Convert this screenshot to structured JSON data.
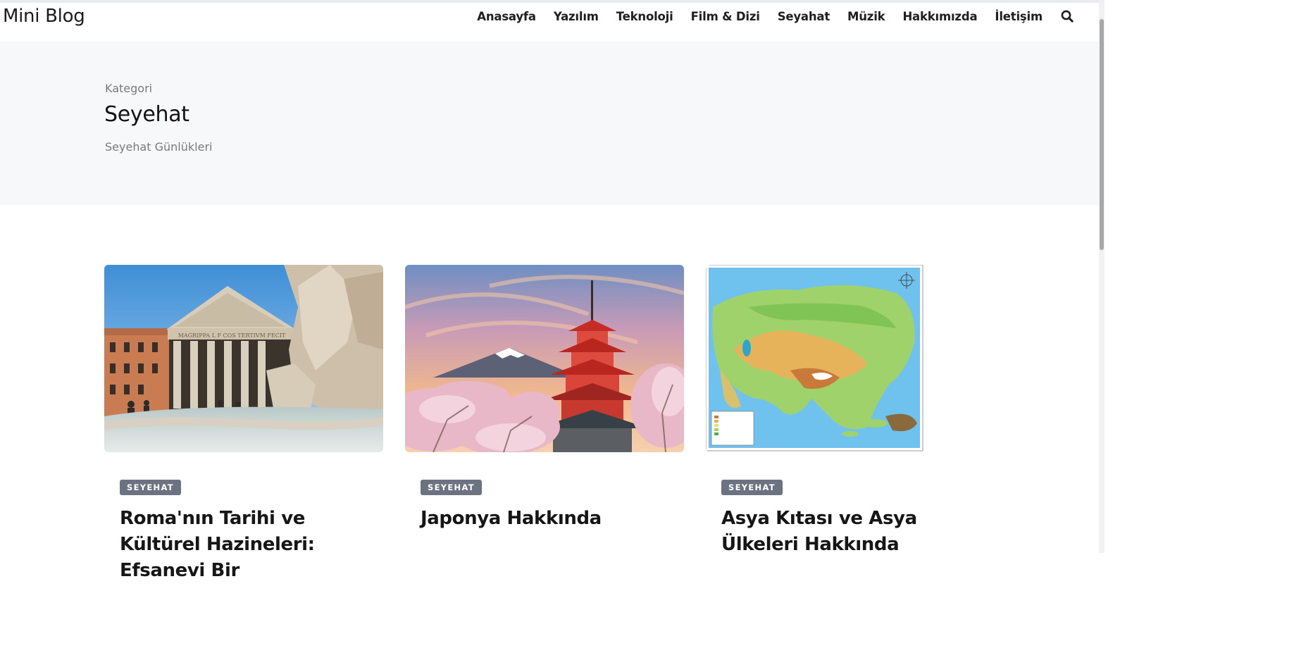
{
  "brand": "Mini Blog",
  "nav": {
    "items": [
      "Anasayfa",
      "Yazılım",
      "Teknoloji",
      "Film & Dizi",
      "Seyahat",
      "Müzik",
      "Hakkımızda",
      "İletişim"
    ],
    "search_icon": "search-icon"
  },
  "hero": {
    "kicker": "Kategori",
    "title": "Seyehat",
    "description": "Seyehat Günlükleri"
  },
  "posts": [
    {
      "category": "SEYEHAT",
      "title": "Roma'nın Tarihi ve Kültürel Hazineleri: Efsanevi Bir",
      "image": "pantheon-rome-photo"
    },
    {
      "category": "SEYEHAT",
      "title": "Japonya Hakkında",
      "image": "mount-fuji-pagoda-photo"
    },
    {
      "category": "SEYEHAT",
      "title": "Asya Kıtası ve Asya Ülkeleri Hakkında",
      "image": "asia-physical-map"
    }
  ],
  "colors": {
    "badge": "#6b7280",
    "hero_bg": "#f7f8f9",
    "text": "#161616"
  }
}
